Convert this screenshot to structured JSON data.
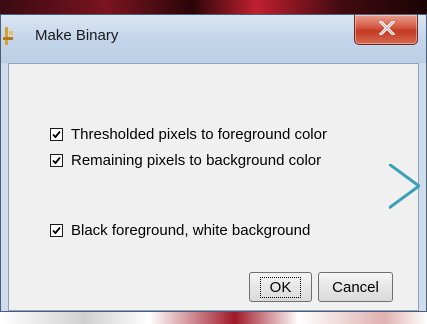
{
  "dialog": {
    "title": "Make Binary",
    "close_glyph": "x"
  },
  "options": [
    {
      "label": "Thresholded pixels to foreground color",
      "checked": true
    },
    {
      "label": "Remaining pixels to background color",
      "checked": true
    },
    {
      "label": "Black foreground, white background",
      "checked": true
    }
  ],
  "buttons": {
    "ok": "OK",
    "cancel": "Cancel"
  },
  "colors": {
    "dialog_bg": "#f0f0f0",
    "frame": "#cfdcec",
    "close_button": "#c23a22",
    "accent_chevron": "#3aa0b8"
  },
  "icons": {
    "app": "app-icon",
    "close": "close-icon",
    "check": "checkmark-icon"
  }
}
